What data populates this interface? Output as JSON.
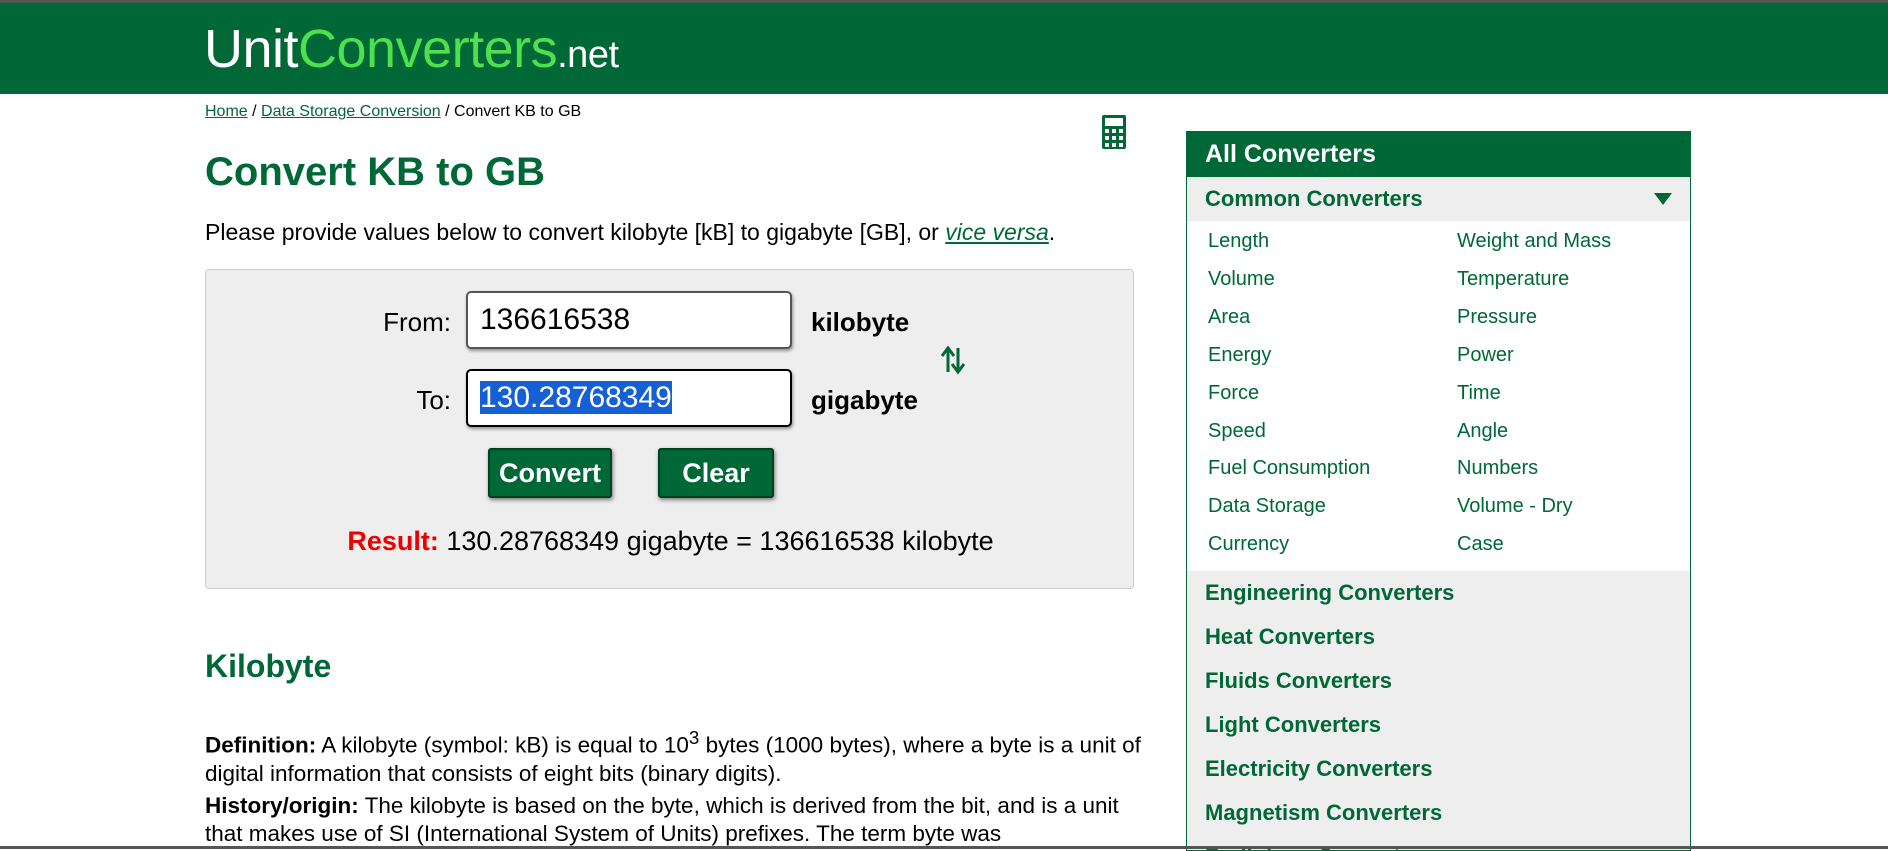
{
  "site": {
    "logo_a": "Unit",
    "logo_b": "Converters",
    "logo_c": ".net"
  },
  "breadcrumb": {
    "home": "Home",
    "sep1": " / ",
    "section": "Data Storage Conversion",
    "sep2": " / ",
    "current": "Convert KB to GB"
  },
  "page_title": "Convert KB to GB",
  "intro": {
    "text": "Please provide values below to convert kilobyte [kB] to gigabyte [GB], or ",
    "link": "vice versa",
    "end": "."
  },
  "converter": {
    "from_label": "From:",
    "from_value": "136616538",
    "from_unit": "kilobyte",
    "to_label": "To:",
    "to_value": "130.28768349",
    "to_unit": "gigabyte",
    "convert_label": "Convert",
    "clear_label": "Clear",
    "result_label": "Result:",
    "result_text": " 130.28768349 gigabyte = 136616538 kilobyte"
  },
  "section": {
    "heading": "Kilobyte",
    "def_label": "Definition:",
    "def_text_a": " A kilobyte (symbol: kB) is equal to 10",
    "def_sup": "3",
    "def_text_b": " bytes (1000 bytes), where a byte is a unit of digital information that consists of eight bits (binary digits).",
    "hist_label": "History/origin:",
    "hist_text": " The kilobyte is based on the byte, which is derived from the bit, and is a unit that makes use of SI (International System of Units) prefixes. The term byte was"
  },
  "sidebar": {
    "header": "All Converters",
    "common": "Common Converters",
    "links": [
      "Length",
      "Weight and Mass",
      "Volume",
      "Temperature",
      "Area",
      "Pressure",
      "Energy",
      "Power",
      "Force",
      "Time",
      "Speed",
      "Angle",
      "Fuel Consumption",
      "Numbers",
      "Data Storage",
      "Volume - Dry",
      "Currency",
      "Case"
    ],
    "categories": [
      "Engineering Converters",
      "Heat Converters",
      "Fluids Converters",
      "Light Converters",
      "Electricity Converters",
      "Magnetism Converters",
      "Radiology Converters"
    ]
  },
  "colors": {
    "brand": "#006837",
    "logo_accent": "#4ee14e",
    "result_label": "#e00000",
    "selection": "#1560d4"
  },
  "icons": [
    "calculator-icon",
    "swap-arrows-icon",
    "chevron-down-icon"
  ]
}
